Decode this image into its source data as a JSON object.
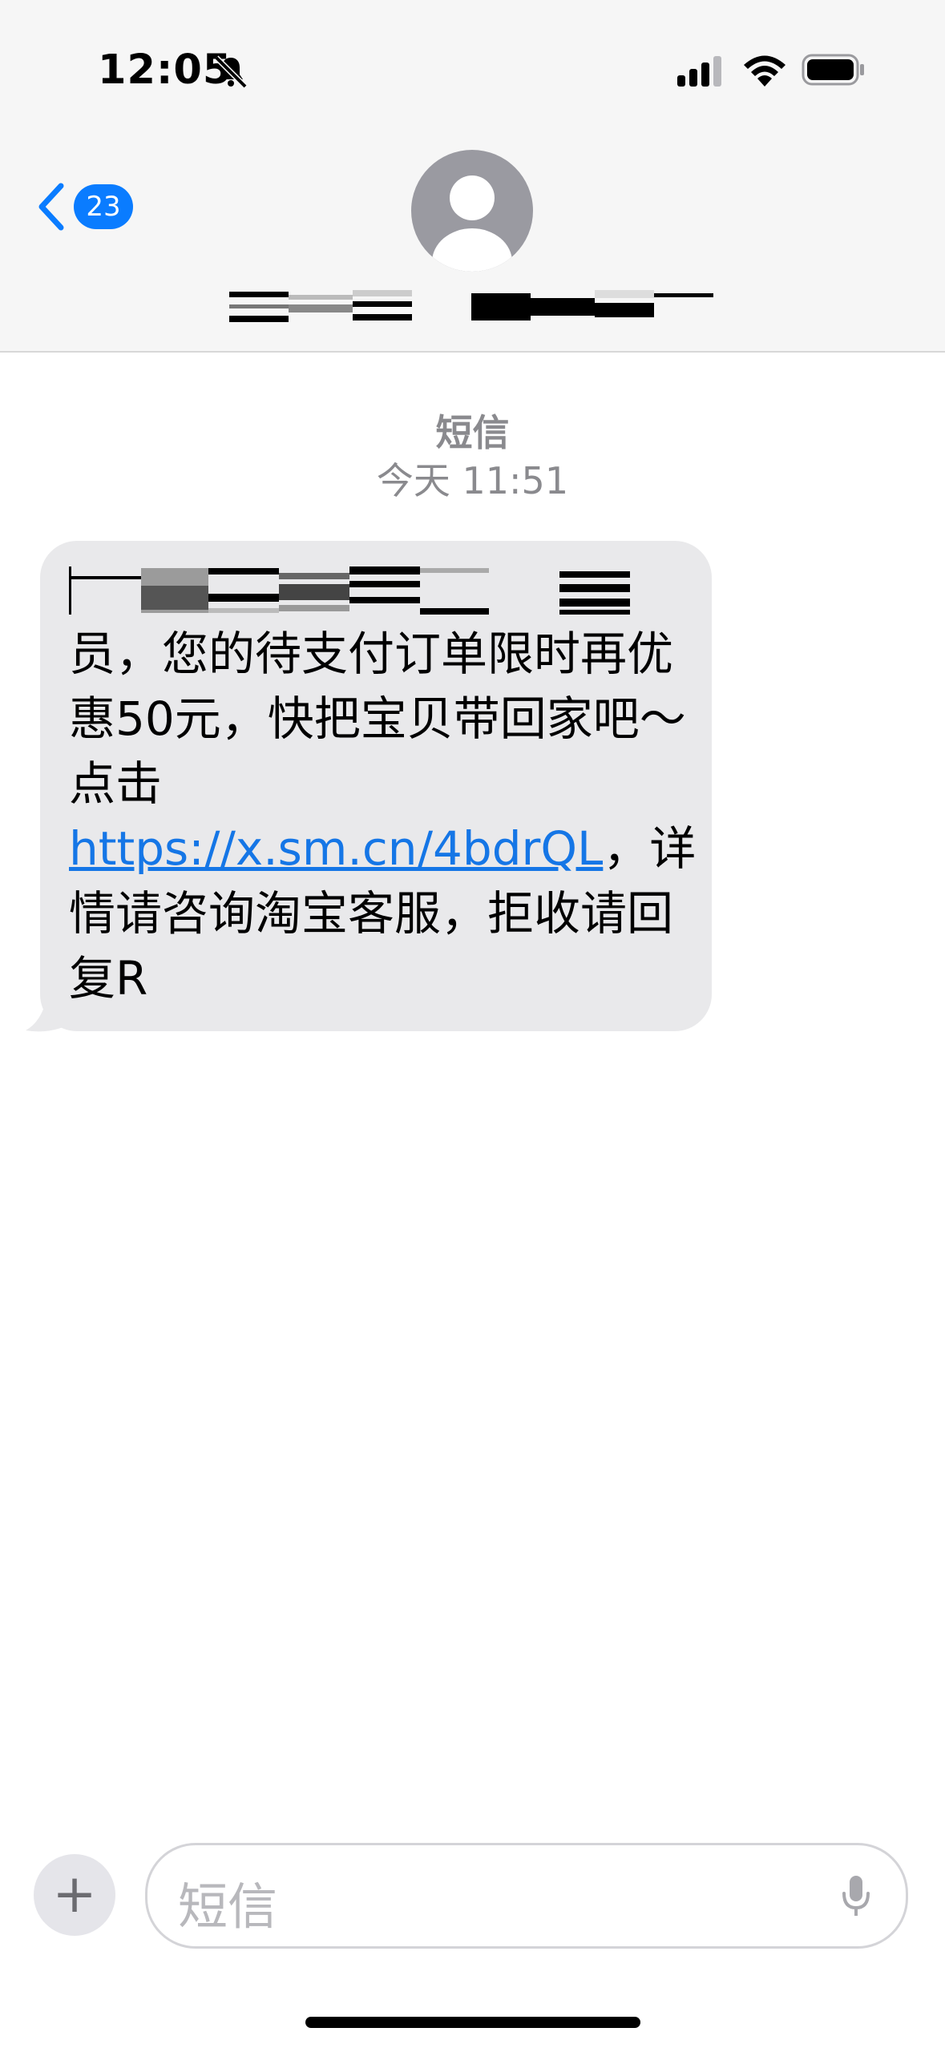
{
  "status_bar": {
    "time": "12:05",
    "silent_icon": "bell-slash-icon",
    "signal_icon": "cellular-signal-icon",
    "wifi_icon": "wifi-icon",
    "battery_icon": "battery-icon"
  },
  "header": {
    "back_icon": "chevron-left-icon",
    "unread_count": "23",
    "contact_name_redacted": true,
    "avatar_icon": "person-avatar-icon"
  },
  "conversation": {
    "service_label": "短信",
    "timestamp": "今天 11:51",
    "messages": [
      {
        "direction": "incoming",
        "redacted_first_line": true,
        "text_before_link": "员，您的待支付订单限时再优惠50元，快把宝贝带回家吧～点击",
        "link": "https://x.sm.cn/4bdrQL",
        "text_after_link": "，详情请咨询淘宝客服，拒收请回复R"
      }
    ]
  },
  "composer": {
    "plus_label": "+",
    "placeholder": "短信",
    "mic_icon": "microphone-icon"
  },
  "colors": {
    "accent": "#0a7cff",
    "link": "#1576e6",
    "bubble_incoming": "#e9e9eb",
    "header_bg": "#f6f6f6"
  }
}
